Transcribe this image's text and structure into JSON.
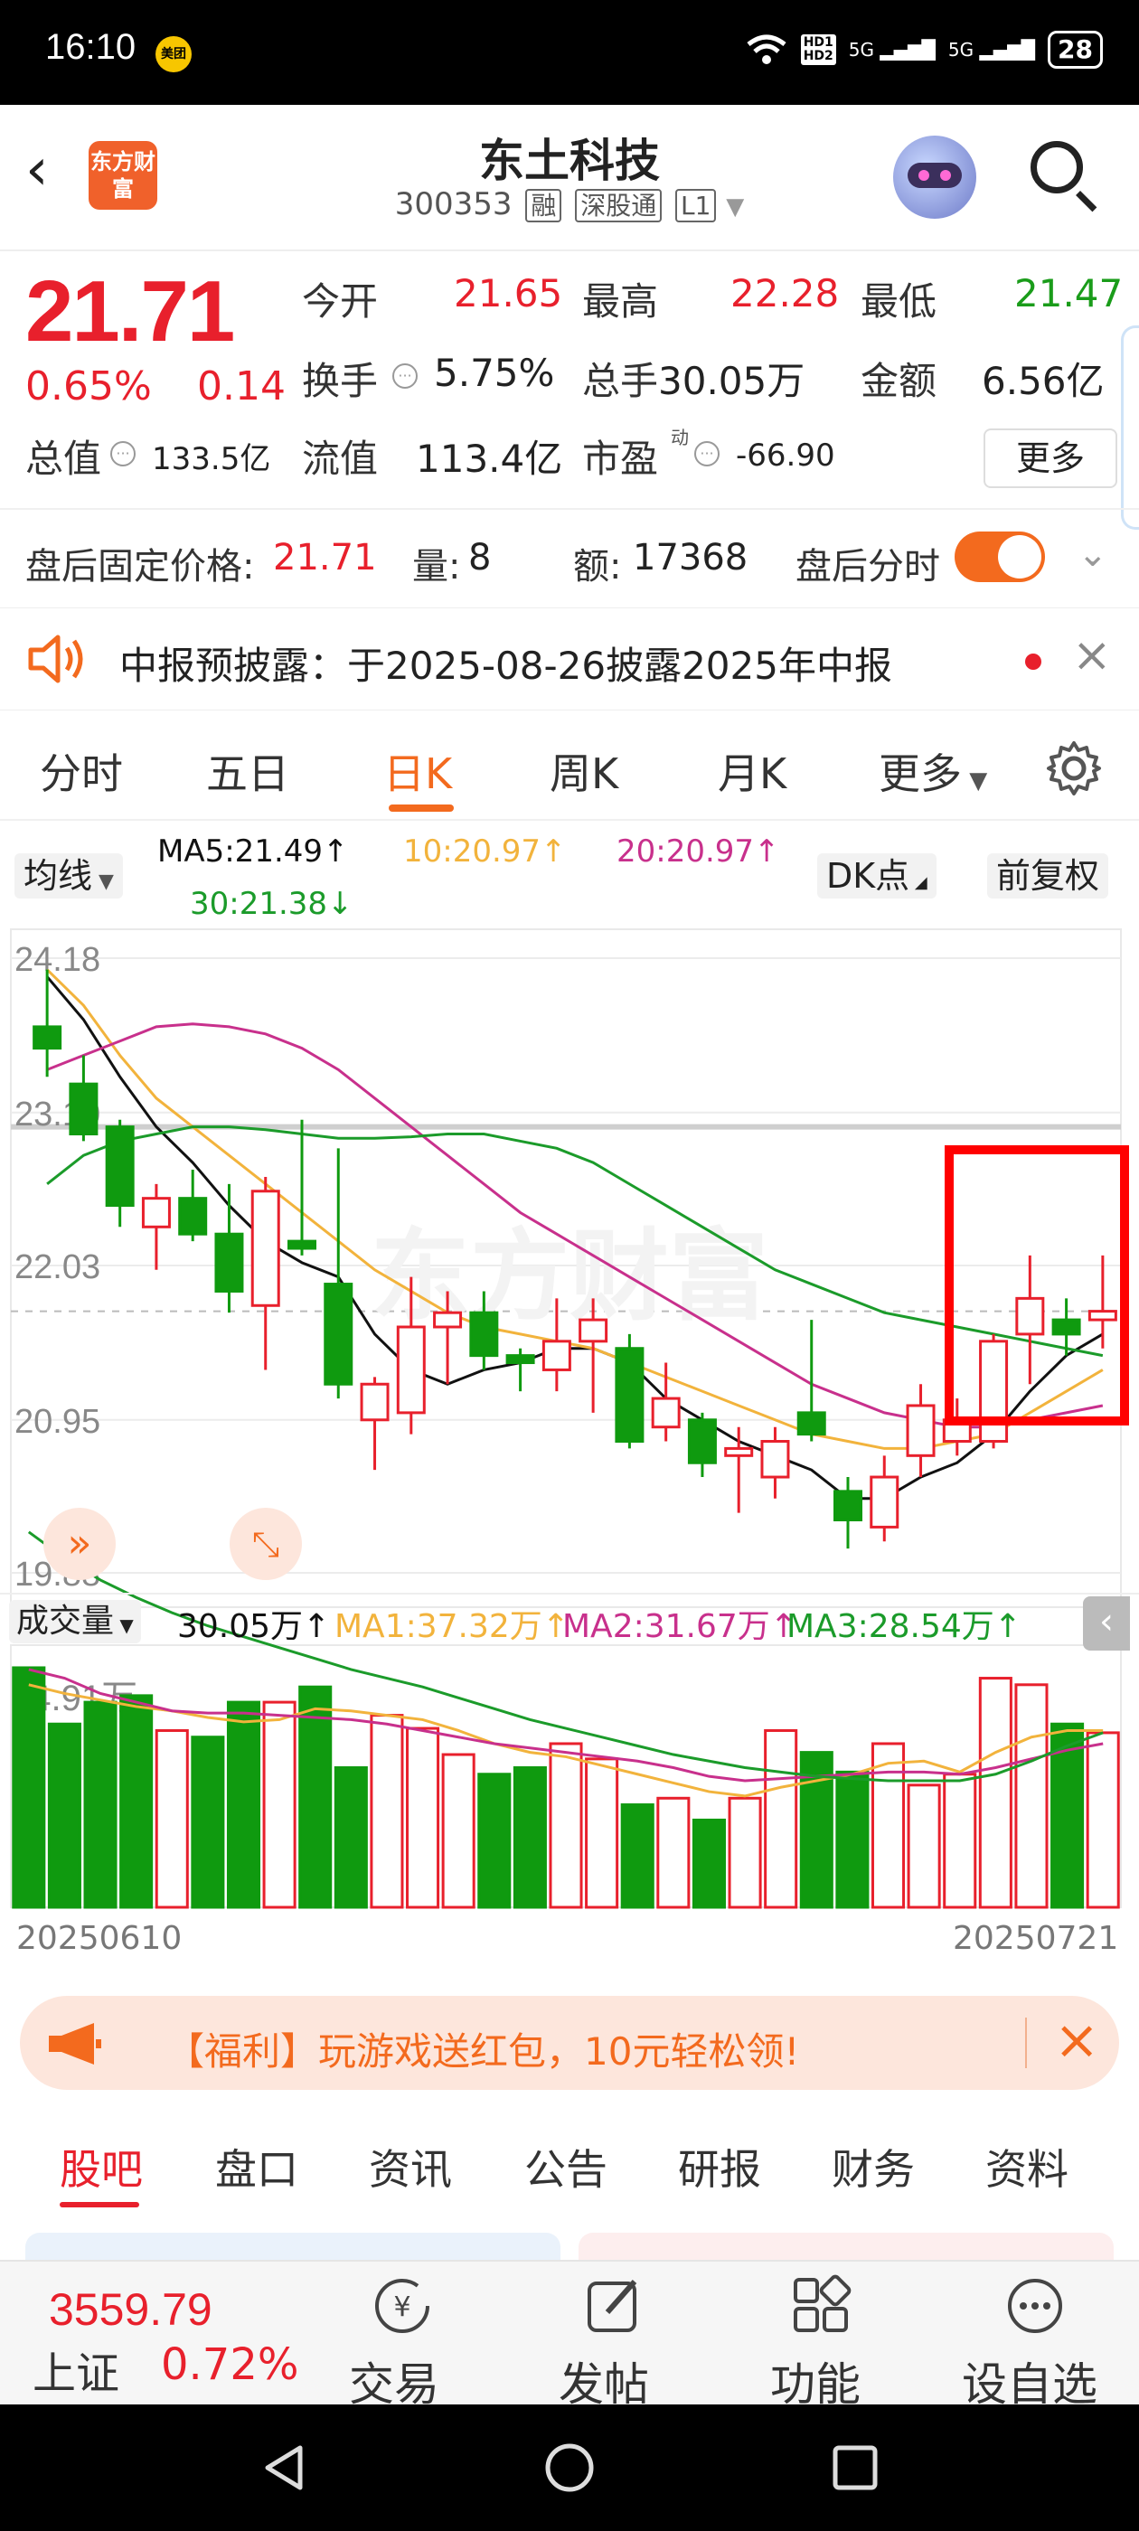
{
  "status_bar": {
    "time": "16:10",
    "app_badge": "美团",
    "network_1": "5G",
    "network_2": "5G",
    "hd1": "HD1",
    "hd2": "HD2",
    "battery": "28"
  },
  "header": {
    "app_logo_text": "东方财富",
    "stock_name": "东土科技",
    "stock_code": "300353",
    "tags": [
      "融",
      "深股通",
      "L1"
    ]
  },
  "quote": {
    "price": "21.71",
    "change_pct": "0.65%",
    "change_abs": "0.14",
    "fields": [
      {
        "label": "今开",
        "value": "21.65",
        "color": "red"
      },
      {
        "label": "最高",
        "value": "22.28",
        "color": "red"
      },
      {
        "label": "最低",
        "value": "21.47",
        "color": "green"
      },
      {
        "label": "换手",
        "value": "5.75%",
        "color": "black"
      },
      {
        "label": "总手",
        "value": "30.05万",
        "color": "black"
      },
      {
        "label": "金额",
        "value": "6.56亿",
        "color": "black"
      },
      {
        "label": "总值",
        "value": "133.5亿",
        "color": "black"
      },
      {
        "label": "流值",
        "value": "113.4亿",
        "color": "black"
      },
      {
        "label": "市盈",
        "value": "-66.90",
        "color": "black"
      }
    ],
    "pe_superscript": "动",
    "more_button": "更多"
  },
  "after_hours": {
    "price_label": "盘后固定价格:",
    "price": "21.71",
    "vol_label": "量:",
    "vol": "8",
    "amt_label": "额:",
    "amt": "17368",
    "toggle_label": "盘后分时",
    "toggle_on": true
  },
  "notice": {
    "text": "中报预披露：于2025-08-26披露2025年中报"
  },
  "period_tabs": {
    "items": [
      "分时",
      "五日",
      "日K",
      "周K",
      "月K",
      "更多"
    ],
    "active": "日K"
  },
  "chart_header": {
    "indicator_select": "均线",
    "ma5": "MA5:21.49↑",
    "ma10": "10:20.97↑",
    "ma20": "20:20.97↑",
    "ma30": "30:21.38↓",
    "dk_button": "DK点",
    "adjust_button": "前复权"
  },
  "volume_header": {
    "select": "成交量",
    "vol": "30.05万↑",
    "ma1": "MA1:37.32万↑",
    "ma2": "MA2:31.67万↑",
    "ma3": "MA3:28.54万↑"
  },
  "colors": {
    "up": "#e8202c",
    "down": "#0f9a0f",
    "ma5": "#111111",
    "ma10": "#f2b33c",
    "ma20": "#c8308c",
    "ma30": "#1b9b2a",
    "accent": "#f36a1e"
  },
  "chart_data": {
    "type": "candlestick",
    "price_axis_labels": [
      "24.18",
      "23.10",
      "22.03",
      "20.95",
      "19.88"
    ],
    "ylim": [
      19.88,
      24.18
    ],
    "volume_axis_label": "54.91万",
    "x_labels": [
      "20250610",
      "20250721"
    ],
    "candles": [
      {
        "o": 23.7,
        "h": 24.1,
        "l": 23.35,
        "c": 23.55
      },
      {
        "o": 23.3,
        "h": 23.5,
        "l": 22.9,
        "c": 22.95
      },
      {
        "o": 23.0,
        "h": 23.05,
        "l": 22.3,
        "c": 22.45
      },
      {
        "o": 22.3,
        "h": 22.6,
        "l": 22.0,
        "c": 22.5
      },
      {
        "o": 22.5,
        "h": 22.7,
        "l": 22.2,
        "c": 22.25
      },
      {
        "o": 22.25,
        "h": 22.6,
        "l": 21.7,
        "c": 21.85
      },
      {
        "o": 21.75,
        "h": 22.65,
        "l": 21.3,
        "c": 22.55
      },
      {
        "o": 22.2,
        "h": 23.05,
        "l": 22.1,
        "c": 22.15
      },
      {
        "o": 21.9,
        "h": 22.85,
        "l": 21.1,
        "c": 21.2
      },
      {
        "o": 20.95,
        "h": 21.25,
        "l": 20.6,
        "c": 21.2
      },
      {
        "o": 21.0,
        "h": 21.95,
        "l": 20.85,
        "c": 21.6
      },
      {
        "o": 21.6,
        "h": 21.85,
        "l": 21.2,
        "c": 21.7
      },
      {
        "o": 21.7,
        "h": 21.85,
        "l": 21.3,
        "c": 21.4
      },
      {
        "o": 21.4,
        "h": 21.45,
        "l": 21.15,
        "c": 21.35
      },
      {
        "o": 21.3,
        "h": 21.8,
        "l": 21.15,
        "c": 21.5
      },
      {
        "o": 21.5,
        "h": 21.8,
        "l": 21.0,
        "c": 21.65
      },
      {
        "o": 21.45,
        "h": 21.55,
        "l": 20.75,
        "c": 20.8
      },
      {
        "o": 20.9,
        "h": 21.35,
        "l": 20.8,
        "c": 21.1
      },
      {
        "o": 20.95,
        "h": 21.0,
        "l": 20.55,
        "c": 20.65
      },
      {
        "o": 20.7,
        "h": 20.9,
        "l": 20.3,
        "c": 20.75
      },
      {
        "o": 20.55,
        "h": 20.9,
        "l": 20.4,
        "c": 20.8
      },
      {
        "o": 21.0,
        "h": 21.65,
        "l": 20.8,
        "c": 20.85
      },
      {
        "o": 20.45,
        "h": 20.55,
        "l": 20.05,
        "c": 20.25
      },
      {
        "o": 20.2,
        "h": 20.7,
        "l": 20.1,
        "c": 20.55
      },
      {
        "o": 20.7,
        "h": 21.2,
        "l": 20.55,
        "c": 21.05
      },
      {
        "o": 20.8,
        "h": 21.1,
        "l": 20.7,
        "c": 20.95
      },
      {
        "o": 20.8,
        "h": 21.55,
        "l": 20.75,
        "c": 21.5
      },
      {
        "o": 21.55,
        "h": 22.1,
        "l": 21.2,
        "c": 21.8
      },
      {
        "o": 21.65,
        "h": 21.8,
        "l": 21.4,
        "c": 21.55
      },
      {
        "o": 21.65,
        "h": 22.1,
        "l": 21.45,
        "c": 21.71
      }
    ],
    "ma_lines": {
      "ma5": [
        24.05,
        23.75,
        23.35,
        23.0,
        22.75,
        22.45,
        22.2,
        22.05,
        21.95,
        21.55,
        21.3,
        21.2,
        21.3,
        21.35,
        21.45,
        21.45,
        21.35,
        21.1,
        20.95,
        20.8,
        20.7,
        20.6,
        20.4,
        20.4,
        20.55,
        20.65,
        20.85,
        21.15,
        21.4,
        21.55
      ],
      "ma10": [
        24.1,
        23.85,
        23.5,
        23.2,
        23.0,
        22.8,
        22.6,
        22.4,
        22.2,
        22.0,
        21.85,
        21.7,
        21.6,
        21.55,
        21.5,
        21.45,
        21.35,
        21.25,
        21.15,
        21.05,
        20.95,
        20.85,
        20.8,
        20.75,
        20.75,
        20.8,
        20.85,
        21.0,
        21.15,
        21.3
      ],
      "ma20": [
        23.4,
        23.5,
        23.6,
        23.7,
        23.72,
        23.7,
        23.65,
        23.55,
        23.4,
        23.2,
        23.0,
        22.8,
        22.6,
        22.4,
        22.25,
        22.1,
        21.95,
        21.8,
        21.65,
        21.5,
        21.35,
        21.2,
        21.1,
        21.0,
        20.95,
        20.9,
        20.9,
        20.95,
        21.0,
        21.05
      ],
      "ma30": [
        22.6,
        22.8,
        22.9,
        22.95,
        23.0,
        23.0,
        22.98,
        22.95,
        22.92,
        22.92,
        22.93,
        22.95,
        22.95,
        22.9,
        22.85,
        22.75,
        22.6,
        22.45,
        22.3,
        22.15,
        22.0,
        21.9,
        21.8,
        21.7,
        21.65,
        21.6,
        21.55,
        21.5,
        21.45,
        21.4
      ]
    },
    "volumes": [
      54.9,
      42.0,
      47.0,
      48.5,
      40.5,
      39.0,
      47.0,
      47.0,
      50.5,
      32.0,
      44.0,
      41.0,
      35.0,
      30.5,
      32.0,
      37.5,
      34.0,
      23.5,
      25.0,
      20.0,
      25.0,
      40.5,
      35.5,
      31.0,
      37.5,
      28.0,
      30.5,
      52.5,
      51.0,
      42.0,
      40.0
    ],
    "vol_ma1": [
      51.0,
      49.0,
      47.5,
      46.0,
      45.0,
      43.5,
      42.5,
      43.0,
      45.5,
      45.0,
      44.0,
      43.0,
      40.5,
      37.5,
      35.5,
      34.5,
      32.5,
      30.5,
      28.5,
      26.5,
      25.5,
      27.5,
      29.0,
      30.5,
      33.0,
      33.5,
      31.0,
      35.5,
      39.0,
      40.5,
      40.5
    ],
    "vol_ma2": [
      54.5,
      52.5,
      49.0,
      47.0,
      45.0,
      44.5,
      44.5,
      44.0,
      43.5,
      43.0,
      42.0,
      40.5,
      39.0,
      37.5,
      36.5,
      35.5,
      34.5,
      33.5,
      32.0,
      30.0,
      29.0,
      29.5,
      30.0,
      30.5,
      31.0,
      31.0,
      30.5,
      32.0,
      34.0,
      36.0,
      37.5
    ],
    "vol_ma3": [
      86.0,
      80.0,
      75.0,
      71.0,
      67.5,
      64.5,
      62.0,
      59.5,
      57.0,
      54.5,
      52.5,
      50.5,
      48.0,
      45.5,
      43.0,
      41.0,
      39.0,
      37.0,
      35.0,
      33.5,
      32.0,
      31.0,
      30.0,
      29.5,
      29.0,
      29.0,
      29.0,
      30.5,
      33.5,
      37.0,
      40.0
    ]
  },
  "chart_overlay": {
    "watermark": "东方财富"
  },
  "promo_banner": {
    "text": "【福利】玩游戏送红包，10元轻松领!"
  },
  "bottom_tabs": {
    "items": [
      "股吧",
      "盘口",
      "资讯",
      "公告",
      "研报",
      "财务",
      "资料"
    ],
    "active": "股吧"
  },
  "nav_bar": {
    "index_value": "3559.79",
    "index_name": "上证",
    "index_change": "0.72%",
    "items": [
      {
        "label": "交易",
        "icon": "yen-exchange-icon"
      },
      {
        "label": "发帖",
        "icon": "edit-icon"
      },
      {
        "label": "功能",
        "icon": "grid-icon"
      },
      {
        "label": "设自选",
        "icon": "more-dots-icon"
      }
    ]
  }
}
